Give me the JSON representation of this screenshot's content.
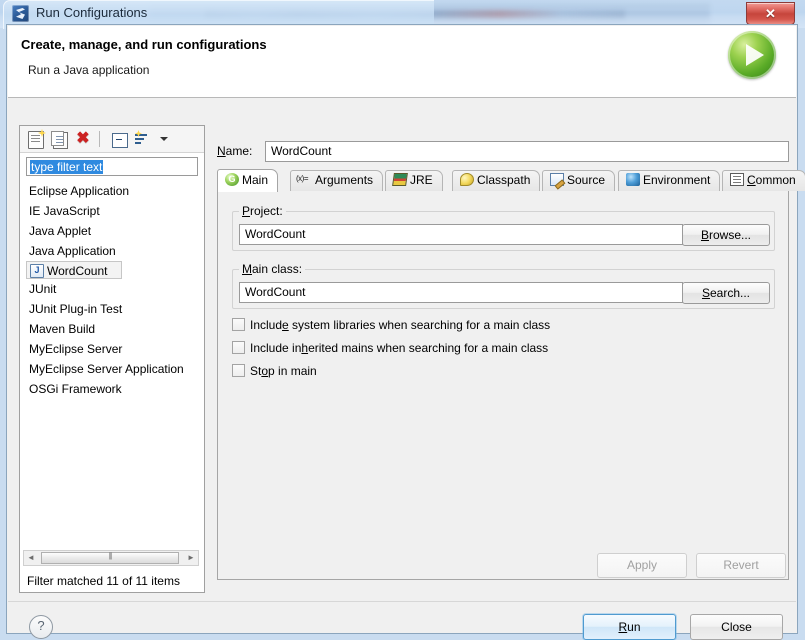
{
  "window": {
    "title": "Run Configurations",
    "title_icon": "eclipse-icon",
    "close_label": "✕"
  },
  "header": {
    "title": "Create, manage, and run configurations",
    "subtitle": "Run a Java application",
    "icon": "run-play-icon"
  },
  "left": {
    "toolbar": [
      {
        "name": "new-launch-configuration-icon",
        "label": ""
      },
      {
        "name": "duplicate-launch-configuration-icon",
        "label": ""
      },
      {
        "name": "delete-launch-configuration-icon",
        "label": "✖"
      },
      {
        "name": "collapse-all-icon",
        "label": ""
      },
      {
        "name": "filter-launch-configurations-icon",
        "label": ""
      }
    ],
    "filter": {
      "value": "type filter text",
      "placeholder": "type filter text",
      "selected": true
    },
    "tree": [
      {
        "label": "Eclipse Application",
        "selected": false,
        "child": false,
        "icon": null
      },
      {
        "label": "IE JavaScript",
        "selected": false,
        "child": false,
        "icon": null
      },
      {
        "label": "Java Applet",
        "selected": false,
        "child": false,
        "icon": null
      },
      {
        "label": "Java Application",
        "selected": false,
        "child": false,
        "icon": null
      },
      {
        "label": "WordCount",
        "selected": true,
        "child": true,
        "icon": "java-class-icon"
      },
      {
        "label": "JUnit",
        "selected": false,
        "child": false,
        "icon": null
      },
      {
        "label": "JUnit Plug-in Test",
        "selected": false,
        "child": false,
        "icon": null
      },
      {
        "label": "Maven Build",
        "selected": false,
        "child": false,
        "icon": null
      },
      {
        "label": "MyEclipse Server",
        "selected": false,
        "child": false,
        "icon": null
      },
      {
        "label": "MyEclipse Server Application",
        "selected": false,
        "child": false,
        "icon": null
      },
      {
        "label": "OSGi Framework",
        "selected": false,
        "child": false,
        "icon": null
      }
    ],
    "scrollbar": {
      "left_arrow": "◄",
      "right_arrow": "►"
    },
    "status": "Filter matched 11 of 11 items"
  },
  "right": {
    "name_label": "Name:",
    "name_mnemonic": "N",
    "name_value": "WordCount",
    "tabs": [
      {
        "label": "Main",
        "icon": "main-tab-icon",
        "active": true
      },
      {
        "label": "Arguments",
        "icon": "arguments-tab-icon",
        "active": false
      },
      {
        "label": "JRE",
        "icon": "jre-tab-icon",
        "active": false
      },
      {
        "label": "Classpath",
        "icon": "classpath-tab-icon",
        "active": false
      },
      {
        "label": "Source",
        "icon": "source-tab-icon",
        "active": false
      },
      {
        "label": "Environment",
        "icon": "environment-tab-icon",
        "active": false
      },
      {
        "label": "Common",
        "icon": "common-tab-icon",
        "active": false
      }
    ],
    "main_tab": {
      "project_group_label": "Project:",
      "project_value": "WordCount",
      "browse_button": "Browse...",
      "main_class_group_label": "Main class:",
      "main_class_value": "WordCount",
      "search_button": "Search...",
      "checkboxes": [
        {
          "label": "Include system libraries when searching for a main class",
          "checked": false
        },
        {
          "label": "Include inherited mains when searching for a main class",
          "checked": false
        },
        {
          "label": "Stop in main",
          "checked": false
        }
      ]
    },
    "apply_button": "Apply",
    "revert_button": "Revert",
    "apply_enabled": false,
    "revert_enabled": false
  },
  "footer": {
    "help_label": "?",
    "run_button": "Run",
    "close_button": "Close"
  },
  "colors": {
    "accent": "#2f8ae0",
    "run_green": "#5aab27",
    "delete_red": "#cc2222",
    "close_red": "#c6453c"
  }
}
